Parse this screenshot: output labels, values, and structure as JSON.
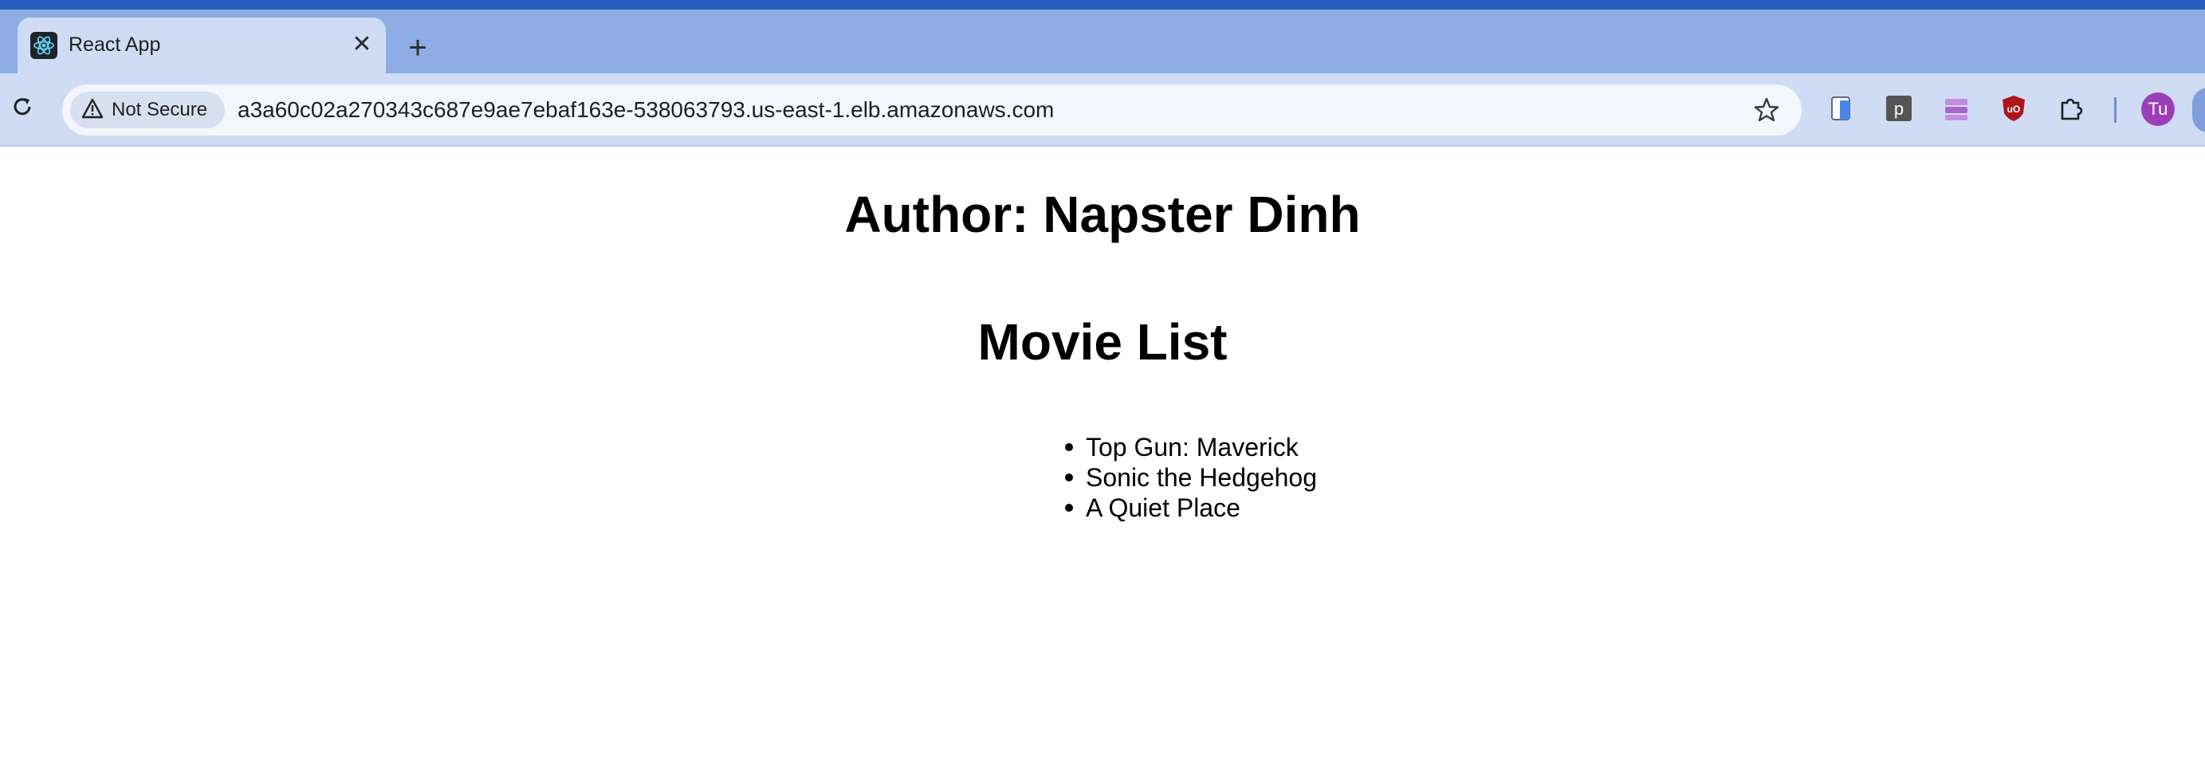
{
  "browser": {
    "tab": {
      "title": "React App",
      "favicon": "react-icon",
      "close_symbol": "✕"
    },
    "new_tab_symbol": "+",
    "toolbar": {
      "security_label": "Not Secure",
      "url": "a3a60c02a270343c687e9ae7ebaf163e-538063793.us-east-1.elb.amazonaws.com",
      "profile_initials": "Tu",
      "extension_p_label": "p",
      "extensions": [
        "clipboard-icon",
        "p-extension-icon",
        "bookmark-manager-icon",
        "ublock-icon",
        "extensions-puzzle-icon"
      ]
    }
  },
  "page": {
    "author_heading": "Author: Napster Dinh",
    "list_heading": "Movie List",
    "movies": [
      "Top Gun: Maverick",
      "Sonic the Hedgehog",
      "A Quiet Place"
    ]
  },
  "colors": {
    "tab_strip": "#8eade4",
    "toolbar": "#cfdcf4",
    "avatar": "#9b3fb8",
    "ublock": "#b0141b"
  }
}
